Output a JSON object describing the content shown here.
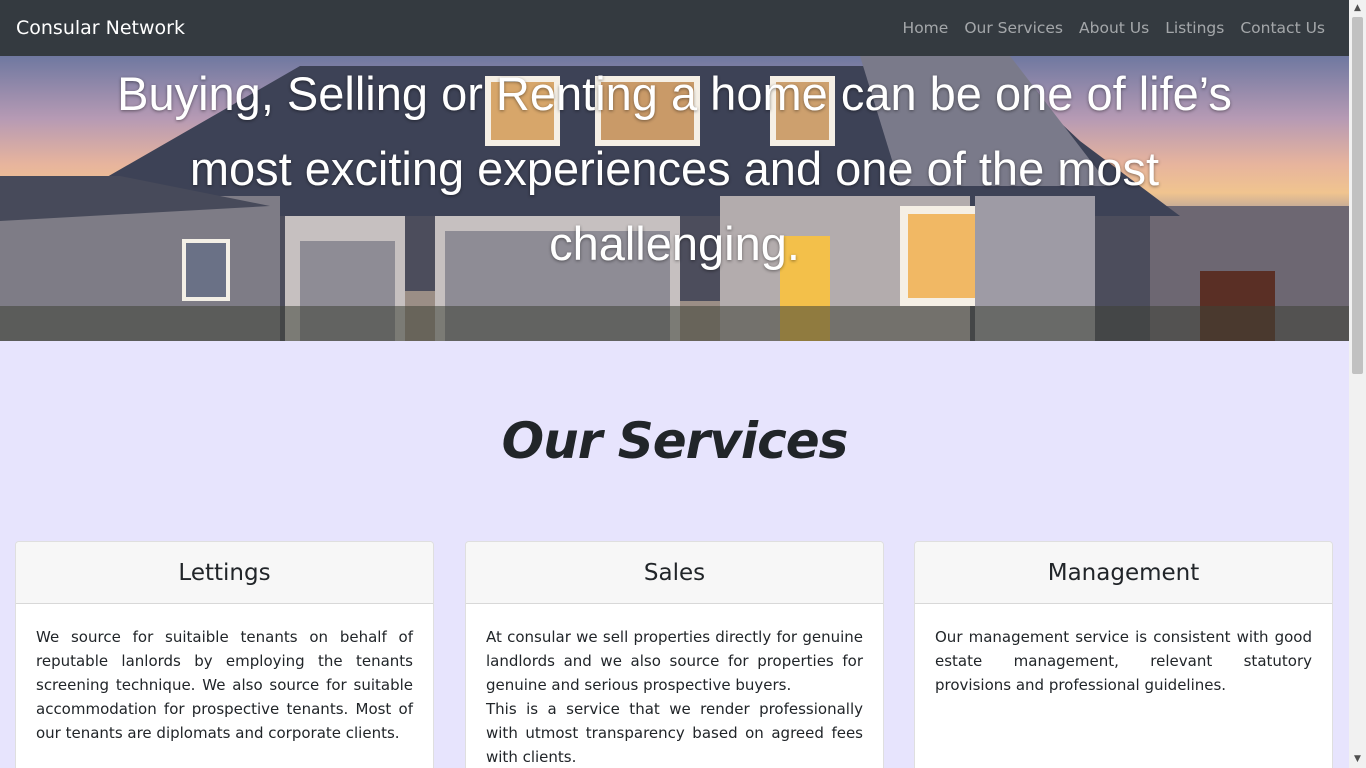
{
  "navbar": {
    "brand": "Consular Network",
    "links": [
      "Home",
      "Our Services",
      "About Us",
      "Listings",
      "Contact Us"
    ]
  },
  "hero": {
    "headline_line1": "Buying, Selling or Renting a home can be one of life’s",
    "headline_line2": "most exciting experiences and one of the most",
    "headline_line3": "challenging."
  },
  "services": {
    "title": "Our Services",
    "cards": [
      {
        "heading": "Lettings",
        "paragraphs": [
          "We source for suitaible tenants on behalf of reputable lanlords by employing the tenants screening technique. We also source for suitable accommodation for prospective tenants. Most of our tenants are diplomats and corporate clients."
        ]
      },
      {
        "heading": "Sales",
        "paragraphs": [
          "At consular we sell properties directly for genuine landlords and we also source for properties for genuine and serious prospective buyers.",
          "This is a service that we render professionally with utmost transparency based on agreed fees with clients."
        ]
      },
      {
        "heading": "Management",
        "paragraphs": [
          "Our management service is consistent with good estate management, relevant statutory provisions and professional guidelines."
        ]
      }
    ]
  },
  "colors": {
    "navbar_bg": "#343a40",
    "page_bg": "#e7e4fd",
    "card_header_bg": "#f7f7f7"
  }
}
